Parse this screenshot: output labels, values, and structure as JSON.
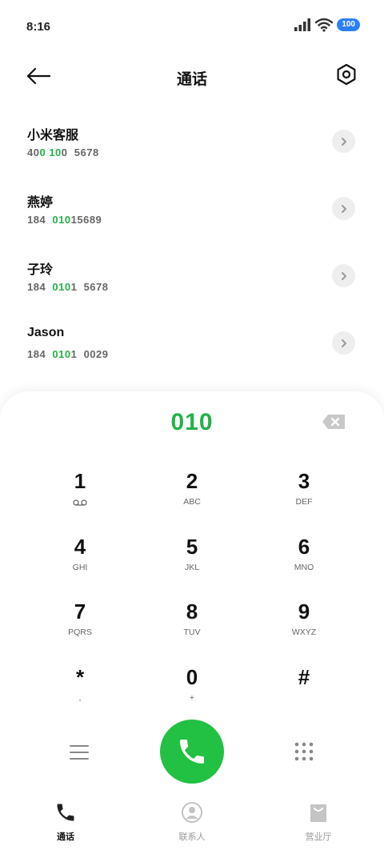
{
  "status_bar": {
    "time": "8:16",
    "battery": "100"
  },
  "header": {
    "title": "通话"
  },
  "results": [
    {
      "name": "小米客服",
      "number_parts": [
        {
          "t": "40",
          "hl": false
        },
        {
          "t": "0",
          "hl": true
        },
        {
          "t": " ",
          "hl": false
        },
        {
          "t": "10",
          "hl": true
        },
        {
          "t": "0  5678",
          "hl": false
        }
      ]
    },
    {
      "name": "燕婷",
      "number_parts": [
        {
          "t": "184  ",
          "hl": false
        },
        {
          "t": "010",
          "hl": true
        },
        {
          "t": "15689",
          "hl": false
        }
      ]
    },
    {
      "name": "子玲",
      "number_parts": [
        {
          "t": "184  ",
          "hl": false
        },
        {
          "t": "010",
          "hl": true
        },
        {
          "t": "1  5678",
          "hl": false
        }
      ]
    },
    {
      "name": "Jason",
      "number_parts": [
        {
          "t": "184  ",
          "hl": false
        },
        {
          "t": "010",
          "hl": true
        },
        {
          "t": "1  0029",
          "hl": false
        }
      ]
    }
  ],
  "dialpad": {
    "input": "010",
    "keys": [
      {
        "digit": "1",
        "letters": "",
        "icon": "voicemail-icon"
      },
      {
        "digit": "2",
        "letters": "ABC"
      },
      {
        "digit": "3",
        "letters": "DEF"
      },
      {
        "digit": "4",
        "letters": "GHI"
      },
      {
        "digit": "5",
        "letters": "JKL"
      },
      {
        "digit": "6",
        "letters": "MNO"
      },
      {
        "digit": "7",
        "letters": "PQRS"
      },
      {
        "digit": "8",
        "letters": "TUV"
      },
      {
        "digit": "9",
        "letters": "WXYZ"
      },
      {
        "digit": "*",
        "letters": ","
      },
      {
        "digit": "0",
        "letters": "+"
      },
      {
        "digit": "#",
        "letters": ""
      }
    ]
  },
  "tabs": [
    {
      "label": "通话",
      "icon": "phone-icon",
      "active": true
    },
    {
      "label": "联系人",
      "icon": "contacts-icon",
      "active": false
    },
    {
      "label": "营业厅",
      "icon": "store-icon",
      "active": false
    }
  ],
  "colors": {
    "accent_green": "#24b14a",
    "call_button": "#22c043",
    "battery_blue": "#2d7ff9"
  }
}
